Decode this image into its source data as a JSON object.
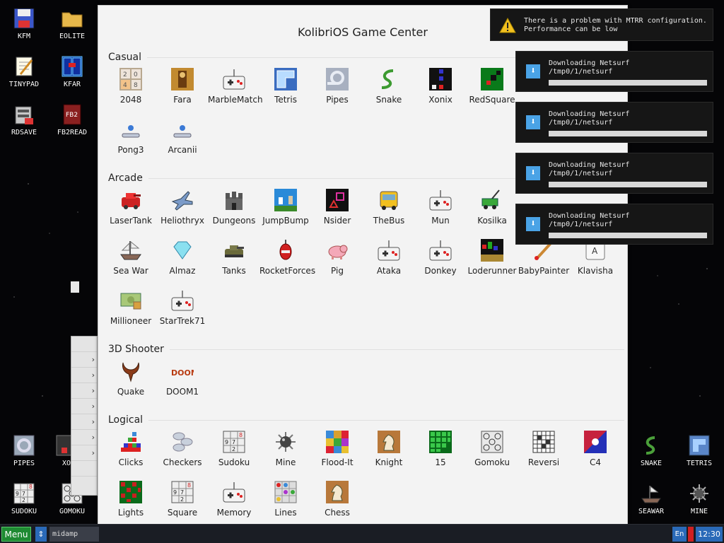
{
  "window": {
    "title": "KolibriOS Game Center"
  },
  "sections": {
    "casual": {
      "title": "Casual",
      "games": [
        "2048",
        "Fara",
        "MarbleMatch",
        "Tetris",
        "Pipes",
        "Snake",
        "Xonix",
        "RedSquare",
        "Pong3",
        "Arcanii"
      ]
    },
    "arcade": {
      "title": "Arcade",
      "games": [
        "LaserTank",
        "Heliothryx",
        "Dungeons",
        "JumpBump",
        "Nsider",
        "TheBus",
        "Mun",
        "Kosilka",
        "Sea War",
        "Almaz",
        "Tanks",
        "RocketForces",
        "Pig",
        "Ataka",
        "Donkey",
        "Loderunner",
        "BabyPainter",
        "Klavisha",
        "Millioneer",
        "StarTrek71"
      ]
    },
    "shooter": {
      "title": "3D Shooter",
      "games": [
        "Quake",
        "DOOM1"
      ]
    },
    "logical": {
      "title": "Logical",
      "games": [
        "Clicks",
        "Checkers",
        "Sudoku",
        "Mine",
        "Flood-It",
        "Knight",
        "15",
        "Gomoku",
        "Reversi",
        "C4",
        "Lights",
        "Square",
        "Memory",
        "Lines",
        "Chess"
      ]
    }
  },
  "desktop_left": [
    "KFM",
    "EOLITE",
    "TINYPAD",
    "KFAR",
    "RDSAVE",
    "FB2READ",
    "PIPES",
    "XO",
    "SUDOKU",
    "GOMOKU"
  ],
  "desktop_right": [
    "SNAKE",
    "TETRIS",
    "SEAWAR",
    "MINE"
  ],
  "notifications": {
    "mtrr": {
      "line1": "There is a problem with MTRR configuration.",
      "line2": "Performance can be low"
    },
    "downloads": [
      {
        "title": "Downloading Netsurf",
        "path": "/tmp0/1/netsurf",
        "progress": 0.0
      },
      {
        "title": "Downloading Netsurf",
        "path": "/tmp0/1/netsurf",
        "progress": 0.0
      },
      {
        "title": "Downloading Netsurf",
        "path": "/tmp0/1/netsurf",
        "progress": 0.0
      },
      {
        "title": "Downloading Netsurf",
        "path": "/tmp0/1/netsurf",
        "progress": 0.0
      }
    ]
  },
  "taskbar": {
    "menu_label": "Menu",
    "task_label": "midamp",
    "lang": "En",
    "clock": "12:30"
  },
  "colors": {
    "taskbar_bg": "#1a1d24",
    "menu_green": "#1e8a32",
    "accent_blue": "#2a6ab8",
    "window_bg": "#f3f3f3"
  }
}
